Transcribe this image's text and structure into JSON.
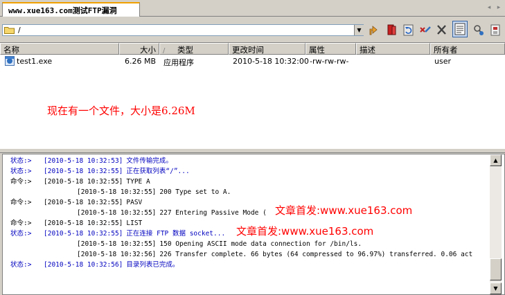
{
  "tab": {
    "title": "www.xue163.com测试FTP漏洞"
  },
  "nav": {
    "left": "◂",
    "right": "▸"
  },
  "address": {
    "path": "/",
    "dropdown": "▼"
  },
  "toolbar_icons": [
    "go-up-icon",
    "bookmark-icon",
    "refresh-icon",
    "disconnect-icon",
    "cancel-icon",
    "log-view-icon",
    "settings-icon",
    "preferences-icon"
  ],
  "columns": [
    {
      "label": "名称"
    },
    {
      "label": "大小"
    },
    {
      "label": "类型",
      "sort": "/"
    },
    {
      "label": "更改时间"
    },
    {
      "label": "属性"
    },
    {
      "label": "描述"
    },
    {
      "label": "所有者"
    }
  ],
  "files": [
    {
      "name": "test1.exe",
      "size": "6.26 MB",
      "type": "应用程序",
      "modified": "2010-5-18 10:32:00",
      "attrs": "-rw-rw-rw-",
      "desc": "",
      "owner": "user"
    }
  ],
  "annotation": "现在有一个文件，大小是6.26M",
  "log": [
    {
      "label": "状态:>",
      "ts": "[2010-5-18 10:32:53]",
      "msg": "文件传输完成。",
      "color": "blue"
    },
    {
      "label": "状态:>",
      "ts": "[2010-5-18 10:32:55]",
      "msg": "正在获取列表“/”...",
      "color": "blue"
    },
    {
      "label": "命令:>",
      "ts": "[2010-5-18 10:32:55]",
      "msg": "TYPE A",
      "color": "dark"
    },
    {
      "label": "",
      "ts": "[2010-5-18 10:32:55]",
      "msg": "200 Type set to A.",
      "color": "dark",
      "indent": true
    },
    {
      "label": "命令:>",
      "ts": "[2010-5-18 10:32:55]",
      "msg": "PASV",
      "color": "dark"
    },
    {
      "label": "",
      "ts": "[2010-5-18 10:32:55]",
      "msg": "227 Entering Passive Mode (",
      "color": "dark",
      "indent": true,
      "wm": "文章首发:www.xue163.com"
    },
    {
      "label": "命令:>",
      "ts": "[2010-5-18 10:32:55]",
      "msg": "LIST",
      "color": "dark"
    },
    {
      "label": "状态:>",
      "ts": "[2010-5-18 10:32:55]",
      "msg": "正在连接 FTP 数据 socket...",
      "color": "blue",
      "wm": "文章首发:www.xue163.com"
    },
    {
      "label": "",
      "ts": "[2010-5-18 10:32:55]",
      "msg": "150 Opening ASCII mode data connection for /bin/ls.",
      "color": "dark",
      "indent": true
    },
    {
      "label": "",
      "ts": "[2010-5-18 10:32:56]",
      "msg": "226 Transfer complete. 66 bytes (64 compressed to 96.97%) transferred. 0.06 act",
      "color": "dark",
      "indent": true
    },
    {
      "label": "状态:>",
      "ts": "[2010-5-18 10:32:56]",
      "msg": "目录列表已完成。",
      "color": "blue"
    }
  ],
  "scroll": {
    "up": "▲",
    "down": "▼"
  },
  "colors": {
    "accent": "#f0a000",
    "status_blue": "#0000c0",
    "annotation_red": "#ff0000"
  }
}
